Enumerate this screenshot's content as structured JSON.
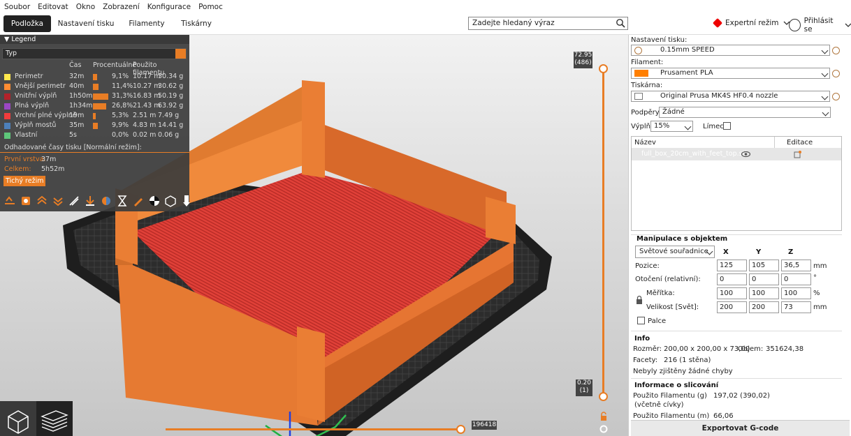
{
  "menu": [
    "Soubor",
    "Editovat",
    "Okno",
    "Zobrazení",
    "Konfigurace",
    "Pomoc"
  ],
  "tabs": [
    "Podložka",
    "Nastavení tisku",
    "Filamenty",
    "Tiskárny"
  ],
  "search": {
    "placeholder": "Zadejte hledaný výraz"
  },
  "mode": {
    "label": "Expertní režim"
  },
  "login": {
    "label": "Přihlásit se"
  },
  "legend": {
    "title": "Legend",
    "view_type": "Typ",
    "columns": {
      "time": "Čas",
      "percent": "Procentuálně",
      "usage": "Použito filamentu"
    },
    "rows": [
      {
        "name": "Perimetr",
        "time": "32m",
        "bar": 0.09,
        "percent": "9,1%",
        "mm": "10.17 m",
        "g": "30.34 g",
        "color": "#ffe84d"
      },
      {
        "name": "Vnější perimetr",
        "time": "40m",
        "bar": 0.114,
        "percent": "11,4%",
        "mm": "10.27 m",
        "g": "30.62 g",
        "color": "#ff8c33"
      },
      {
        "name": "Vnitřní výplň",
        "time": "1h50m",
        "bar": 0.313,
        "percent": "31,3%",
        "mm": "16.83 m",
        "g": "50.19 g",
        "color": "#b3222a"
      },
      {
        "name": "Plná výplň",
        "time": "1h34m",
        "bar": 0.268,
        "percent": "26,8%",
        "mm": "21.43 m",
        "g": "63.92 g",
        "color": "#9a47c4"
      },
      {
        "name": "Vrchní plné výplně",
        "time": "19m",
        "bar": 0.053,
        "percent": "5,3%",
        "mm": "2.51 m",
        "g": "7.49 g",
        "color": "#f03c3c"
      },
      {
        "name": "Výplň mostů",
        "time": "35m",
        "bar": 0.099,
        "percent": "9,9%",
        "mm": "4.83 m",
        "g": "14.41 g",
        "color": "#4d80ba"
      },
      {
        "name": "Vlastní",
        "time": "5s",
        "bar": 0.0,
        "percent": "0,0%",
        "mm": "0.02 m",
        "g": "0.06 g",
        "color": "#5ec77a"
      }
    ],
    "estimate_title": "Odhadované časy tisku [Normální režim]:",
    "first_layer_label": "První vrstva:",
    "first_layer_value": "37m",
    "total_label": "Celkem:",
    "total_value": "5h52m",
    "quiet_button": "Tichý režim"
  },
  "sliders": {
    "top_value": "72.95",
    "top_layer": "(486)",
    "bottom_value": "0.20",
    "bottom_layer": "(1)",
    "horizontal_value": "196418"
  },
  "panel": {
    "print_settings_label": "Nastavení tisku:",
    "print_settings_value": "0.15mm SPEED",
    "filament_label": "Filament:",
    "filament_value": "Prusament PLA",
    "filament_color": "#ff7f00",
    "printer_label": "Tiskárna:",
    "printer_value": "Original Prusa MK4S HF0.4 nozzle",
    "supports_label": "Podpěry:",
    "supports_value": "Žádné",
    "infill_label": "Výplň:",
    "infill_value": "15%",
    "brim_label": "Límec:",
    "list_col_name": "Název",
    "list_col_edit": "Editace",
    "object_name": "full_box_20cm_with_feet_top.stl"
  },
  "manip": {
    "title": "Manipulace s objektem",
    "coords": "Světové souřadnice",
    "x": "X",
    "y": "Y",
    "z": "Z",
    "position_label": "Pozice:",
    "pos": [
      "125",
      "105",
      "36,5"
    ],
    "pos_unit": "mm",
    "rotation_label": "Otočení (relativní):",
    "rot": [
      "0",
      "0",
      "0"
    ],
    "rot_unit": "°",
    "scale_label": "Měřítka:",
    "scale": [
      "100",
      "100",
      "100"
    ],
    "scale_unit": "%",
    "size_label": "Velikost [Svět]:",
    "size": [
      "200",
      "200",
      "73"
    ],
    "size_unit": "mm",
    "inches_label": "Palce"
  },
  "info": {
    "title": "Info",
    "size_label": "Rozměr:",
    "size_value": "200,00 x 200,00 x 73,00",
    "volume_label": "Objem:",
    "volume_value": "351624,38",
    "facets_label": "Facety:",
    "facets_value": "216 (1 stěna)",
    "errors": "Nebyly zjištěny žádné chyby"
  },
  "slice": {
    "title": "Informace o slicování",
    "used_g_label": "Použito Filamentu (g)",
    "used_g_sub": "(včetně cívky)",
    "used_g_value": "197,02 (390,02)",
    "used_m_label": "Použito Filamentu (m)",
    "used_m_value": "66,06"
  },
  "export_button": "Exportovat G-code"
}
